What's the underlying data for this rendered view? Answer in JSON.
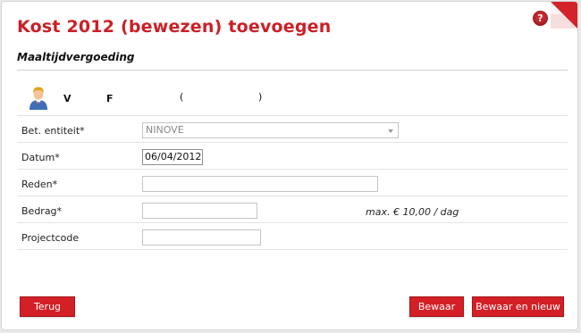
{
  "header": {
    "title": "Kost 2012 (bewezen) toevoegen",
    "subtitle": "Maaltijdvergoeding",
    "help_glyph": "?"
  },
  "person": {
    "first": "V",
    "second": "F",
    "paren_open": "(",
    "paren_close": ")"
  },
  "form": {
    "entity_label": "Bet. entiteit*",
    "entity_value": "NINOVE",
    "date_label": "Datum*",
    "date_value": "06/04/2012",
    "reason_label": "Reden*",
    "reason_value": "",
    "amount_label": "Bedrag*",
    "amount_value": "",
    "amount_hint": "max. € 10,00 / dag",
    "project_label": "Projectcode",
    "project_value": ""
  },
  "buttons": {
    "back": "Terug",
    "save": "Bewaar",
    "save_new": "Bewaar en nieuw"
  },
  "icons": [
    "help-icon",
    "person-icon",
    "page-corner-icon",
    "dropdown-arrow-icon"
  ],
  "colors": {
    "accent": "#cc1f26",
    "button": "#d41f26"
  }
}
